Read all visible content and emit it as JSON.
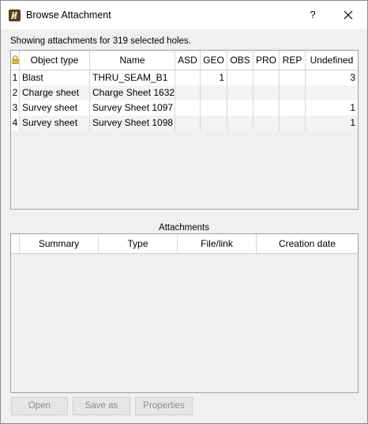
{
  "window": {
    "title": "Browse Attachment",
    "help_label": "?"
  },
  "info_text": "Showing attachments for 319 selected holes.",
  "objects_table": {
    "columns": [
      "Object type",
      "Name",
      "ASD",
      "GEO",
      "OBS",
      "PRO",
      "REP",
      "Undefined"
    ],
    "rows": [
      {
        "num": "1",
        "type": "Blast",
        "name": "THRU_SEAM_B1",
        "asd": "",
        "geo": "1",
        "obs": "",
        "pro": "",
        "rep": "",
        "undefined": "3"
      },
      {
        "num": "2",
        "type": "Charge sheet",
        "name": "Charge Sheet 1632",
        "asd": "",
        "geo": "",
        "obs": "",
        "pro": "",
        "rep": "",
        "undefined": ""
      },
      {
        "num": "3",
        "type": "Survey sheet",
        "name": "Survey Sheet 1097",
        "asd": "",
        "geo": "",
        "obs": "",
        "pro": "",
        "rep": "",
        "undefined": "1"
      },
      {
        "num": "4",
        "type": "Survey sheet",
        "name": "Survey Sheet 1098",
        "asd": "",
        "geo": "",
        "obs": "",
        "pro": "",
        "rep": "",
        "undefined": "1"
      }
    ]
  },
  "attachments": {
    "label": "Attachments",
    "columns": [
      "Summary",
      "Type",
      "File/link",
      "Creation date"
    ]
  },
  "buttons": {
    "open": "Open",
    "save_as": "Save as",
    "properties": "Properties"
  },
  "icons": {
    "app": "app-logo-icon",
    "lock": "lock-icon",
    "close": "close-icon"
  }
}
